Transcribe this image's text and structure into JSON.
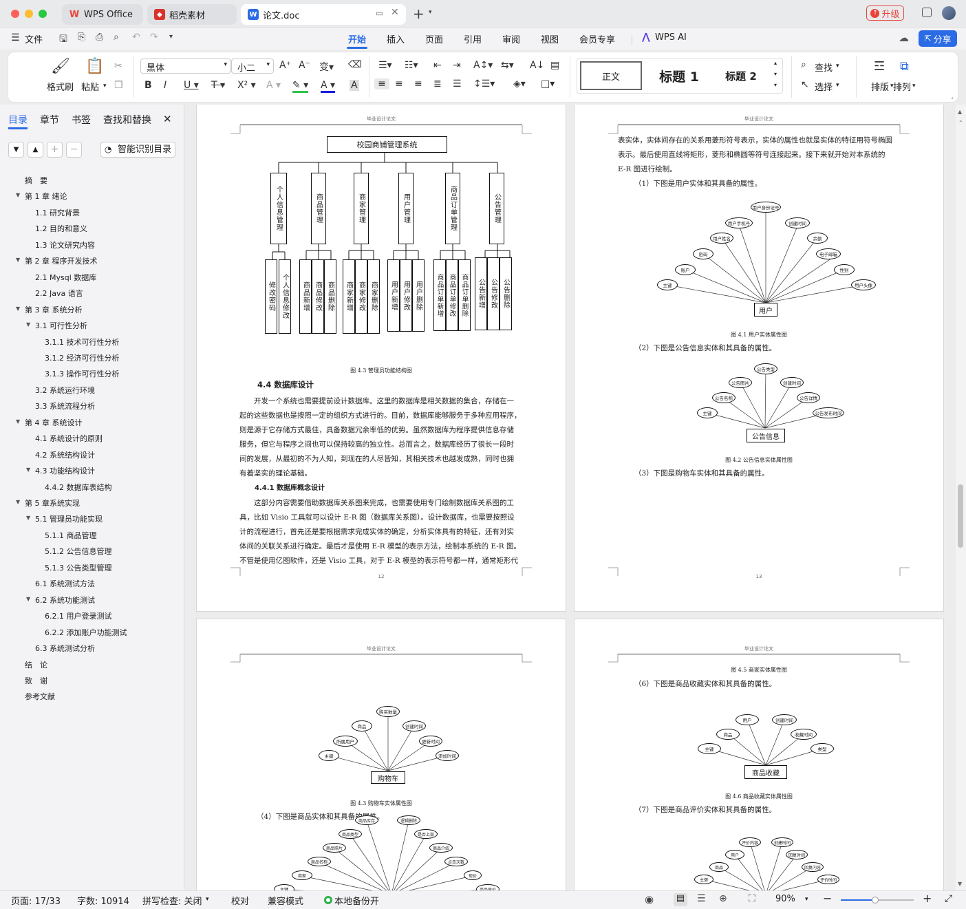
{
  "window": {
    "tabs": [
      {
        "label": "WPS Office"
      },
      {
        "label": "稻壳素材"
      },
      {
        "label": "论文.doc"
      }
    ],
    "upgrade_label": "升级"
  },
  "menu": {
    "file_label": "文件",
    "tabs": [
      "开始",
      "插入",
      "页面",
      "引用",
      "审阅",
      "视图",
      "会员专享"
    ],
    "ai_label": "WPS AI",
    "share_label": "分享"
  },
  "ribbon": {
    "format_painter": "格式刷",
    "paste": "粘贴",
    "font_name": "黑体",
    "font_size": "小二",
    "styles": [
      "正文",
      "标题 1",
      "标题 2"
    ],
    "find": "查找",
    "select": "选择",
    "layout": "排版",
    "arrange": "排列"
  },
  "sidebar": {
    "tabs": [
      "目录",
      "章节",
      "书签",
      "查找和替换"
    ],
    "smart_toc": "智能识别目录",
    "toc": [
      "摘　要",
      "第 1 章  绪论",
      "1.1  研究背景",
      "1.2 目的和意义",
      "1.3  论文研究内容",
      "第 2 章  程序开发技术",
      "2.1 Mysql 数据库",
      "2.2 Java 语言",
      "第 3 章  系统分析",
      "3.1 可行性分析",
      "3.1.1 技术可行性分析",
      "3.1.2 经济可行性分析",
      "3.1.3 操作可行性分析",
      "3.2 系统运行环境",
      "3.3 系统流程分析",
      "第 4 章  系统设计",
      "4.1  系统设计的原则",
      "4.2  系统结构设计",
      "4.3 功能结构设计",
      "4.4.2  数据库表结构",
      "第 5 章系统实现",
      "5.1 管理员功能实现",
      "5.1.1  商品管理",
      "5.1.2  公告信息管理",
      "5.1.3 公告类型管理",
      "6.1 系统测试方法",
      "6.2  系统功能测试",
      "6.2.1  用户登录测试",
      "6.2.2  添加账户功能测试",
      "6.3  系统测试分析",
      "结　论",
      "致　谢",
      "参考文献"
    ]
  },
  "doc": {
    "header_text": "毕业设计论文",
    "page12": {
      "root": "校园商铺管理系统",
      "modules": [
        "个人信息管理",
        "商品管理",
        "商家管理",
        "用户管理",
        "商品订单管理",
        "公告管理"
      ],
      "subs": [
        [
          "修改密码",
          "个人信息修改"
        ],
        [
          "商品新增",
          "商品修改",
          "商品删除"
        ],
        [
          "商家新增",
          "商家修改",
          "商家删除"
        ],
        [
          "用户新增",
          "用户修改",
          "用户删除"
        ],
        [
          "商品订单新增",
          "商品订单修改",
          "商品订单删除"
        ],
        [
          "公告新增",
          "公告修改",
          "公告删除"
        ]
      ],
      "fig_caption": "图 4.3  管理员功能结构图",
      "heading": "4.4  数据库设计",
      "para1": [
        "开发一个系统也需要提前设计数据库。这里的数据库是相关数据的集合，存储在一",
        "起的这些数据也是按照一定的组织方式进行的。目前，数据库能够服务于多种应用程序，",
        "则是源于它存储方式最佳，具备数据冗余率低的优势。虽然数据库为程序提供信息存储",
        "服务，但它与程序之间也可以保持较高的独立性。总而言之，数据库经历了很长一段时",
        "间的发展，从最初的不为人知，到现在的人尽皆知，其相关技术也越发成熟，同时也拥",
        "有着坚实的理论基础。"
      ],
      "subheading": "4.4.1  数据库概念设计",
      "para2": [
        "这部分内容需要借助数据库关系图来完成，也需要使用专门绘制数据库关系图的工",
        "具，比如 Visio 工具就可以设计 E-R 图（数据库关系图）。设计数据库，也需要按照设",
        "计的流程进行，首先还是要根据需求完成实体的确定，分析实体具有的特征，还有对实",
        "体间的关联关系进行确定。最后才是使用 E-R 模型的表示方法，绘制本系统的 E-R 图。",
        "不管是使用亿图软件，还是 Visio 工具，对于 E-R 模型的表示符号都一样，通常矩形代"
      ],
      "page_num": "12"
    },
    "page13": {
      "para": [
        "表实体，实体间存在的关系用菱形符号表示，实体的属性也就是实体的特征用符号椭圆",
        "表示。最后使用直线将矩形，菱形和椭圆等符号连接起来。接下来就开始对本系统的",
        "E-R 图进行绘制。"
      ],
      "item1": "（1）下图是用户实体和其具备的属性。",
      "user_entity": "用户",
      "user_attrs": [
        "主键",
        "账户",
        "密码",
        "用户姓名",
        "用户手机号",
        "用户身份证号",
        "创建时间",
        "余额",
        "电子邮箱",
        "性别",
        "用户头像"
      ],
      "cap1": "图 4.1  用户实体属性图",
      "item2": "（2）下图是公告信息实体和其具备的属性。",
      "notice_entity": "公告信息",
      "notice_attrs": [
        "主键",
        "公告名称",
        "公告图片",
        "公告类型",
        "创建时间",
        "公告详情",
        "公告发布时间"
      ],
      "cap2": "图 4.2  公告信息实体属性图",
      "item3": "（3）下图是购物车实体和其具备的属性。",
      "page_num": "13"
    },
    "page14": {
      "cart_entity": "购物车",
      "cart_attrs": [
        "主键",
        "所属用户",
        "商品",
        "购买数量",
        "创建时间",
        "更新时间",
        "添加时间"
      ],
      "cap": "图 4.3  购物车实体属性图",
      "item4": "（4）下图是商品实体和其具备的属性。",
      "goods_attrs": [
        "主键",
        "商家",
        "商品名称",
        "商品照片",
        "商品类型",
        "商品库存",
        "逻辑删除",
        "是否上架",
        "商品介绍",
        "点击次数",
        "现价",
        "商品原价"
      ]
    },
    "page15": {
      "cap_top": "图 4.5  商家实体属性图",
      "item6": "（6）下图是商品收藏实体和其具备的属性。",
      "fav_entity": "商品收藏",
      "fav_attrs": [
        "主键",
        "商品",
        "用户",
        "创建时间",
        "收藏时间",
        "类型"
      ],
      "cap6": "图 4.6  商品收藏实体属性图",
      "item7": "（7）下图是商品评价实体和其具备的属性。",
      "review_attrs": [
        "主键",
        "商品",
        "用户",
        "评价内容",
        "创建时间",
        "回复时间",
        "回复内容",
        "评价时间"
      ]
    }
  },
  "status": {
    "page": "页面: 17/33",
    "words": "字数: 10914",
    "spell": "拼写检查: 关闭",
    "proof": "校对",
    "compat": "兼容模式",
    "backup": "本地备份开",
    "zoom": "90%"
  },
  "colors": {
    "accent": "#2b6be6",
    "wps_red": "#e8443a",
    "daoke_red": "#d9342b"
  }
}
